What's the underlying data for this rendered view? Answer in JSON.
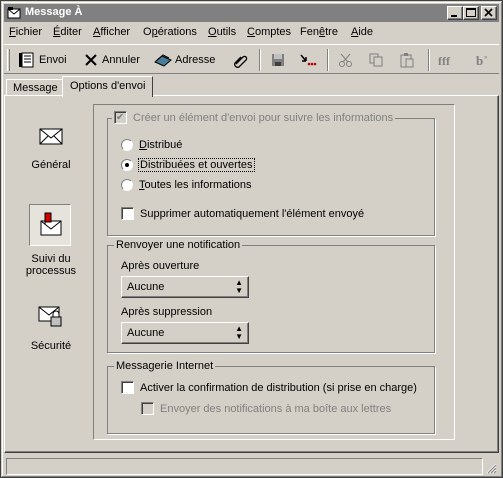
{
  "window": {
    "title": "Message À",
    "controls": {
      "minimize": "_",
      "maximize": "□",
      "close": "×"
    }
  },
  "menu": [
    {
      "label": "Fichier",
      "key": "F",
      "rest": "ichier"
    },
    {
      "label": "Éditer",
      "key": "É",
      "rest": "diter"
    },
    {
      "label": "Afficher",
      "key": "A",
      "rest": "fficher"
    },
    {
      "label": "Opérations",
      "pre": "O",
      "key": "p",
      "rest": "érations"
    },
    {
      "label": "Outils",
      "key": "O",
      "rest": "utils"
    },
    {
      "label": "Comptes",
      "key": "C",
      "rest": "omptes"
    },
    {
      "label": "Fenêtre",
      "pre": "Fen",
      "key": "ê",
      "rest": "tre"
    },
    {
      "label": "Aide",
      "key": "A",
      "rest": "ide"
    }
  ],
  "toolbar": {
    "send_label": "Envoi",
    "cancel_label": "Annuler",
    "address_label": "Adresse"
  },
  "tabs": [
    {
      "label": "Message"
    },
    {
      "label": "Options d'envoi"
    }
  ],
  "nav": [
    {
      "label": "Général",
      "icon": "envelope-icon"
    },
    {
      "label_line1": "Suivi du",
      "label_line2": "processus",
      "icon": "tracking-icon"
    },
    {
      "label": "Sécurité",
      "icon": "lock-envelope-icon"
    }
  ],
  "tracking": {
    "create_item_label": "Créer un élément d'envoi pour suivre les informations",
    "create_item_checked": true,
    "options": [
      {
        "label": "Distribué",
        "key": "D",
        "rest": "istribué",
        "selected": false
      },
      {
        "label": "Distribuées et ouvertes",
        "selected": true
      },
      {
        "label": "Toutes les informations",
        "key": "T",
        "rest": "outes les informations",
        "selected": false
      }
    ],
    "auto_delete_label": "Supprimer automatiquement l'élément envoyé",
    "auto_delete_checked": false
  },
  "notification": {
    "legend": "Renvoyer une notification",
    "after_open_label": "Après ouverture",
    "after_open_value": "Aucune",
    "after_delete_label": "Après suppression",
    "after_delete_value": "Aucune"
  },
  "internet": {
    "legend": "Messagerie Internet",
    "enable_label": "Activer la confirmation de distribution (si prise en charge)",
    "enable_checked": false,
    "send_notifs_label": "Envoyer des notifications à ma boîte aux lettres",
    "send_notifs_checked": false
  },
  "colors": {
    "face": "#d4d0c8",
    "title_inactive": "#808080",
    "disabled_text": "#808080"
  }
}
